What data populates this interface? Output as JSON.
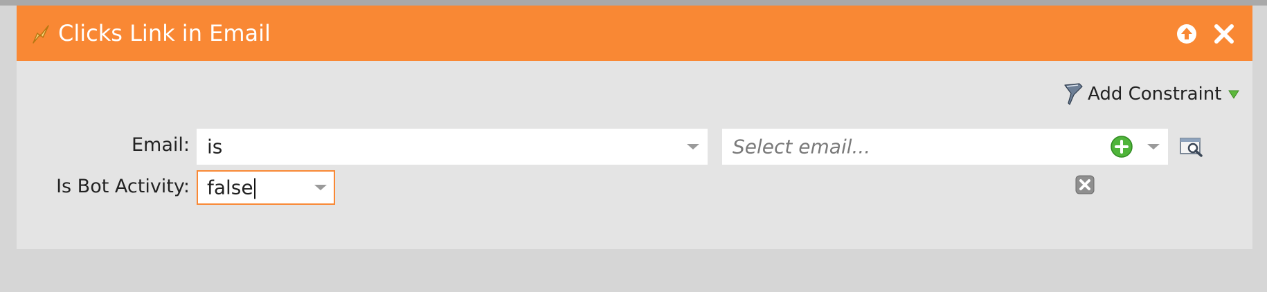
{
  "filter": {
    "title": "Clicks Link in Email",
    "title_icon": "filter-lightning-icon",
    "header_buttons": [
      "collapse-up-icon",
      "close-icon"
    ],
    "colors": {
      "header": "#f98834",
      "panel": "#e4e4e4",
      "focus_border": "#f98834"
    }
  },
  "toolbar": {
    "add_constraint_label": "Add Constraint",
    "add_constraint_icon": "funnel-icon"
  },
  "rows": {
    "email": {
      "label": "Email:",
      "operator": "is",
      "value_placeholder": "Select email...",
      "icons": [
        "add-email-icon",
        "dropdown-caret-icon",
        "preview-email-icon"
      ]
    },
    "bot": {
      "label": "Is Bot Activity:",
      "value": "false",
      "icons": [
        "dropdown-caret-icon",
        "delete-constraint-icon"
      ]
    }
  }
}
